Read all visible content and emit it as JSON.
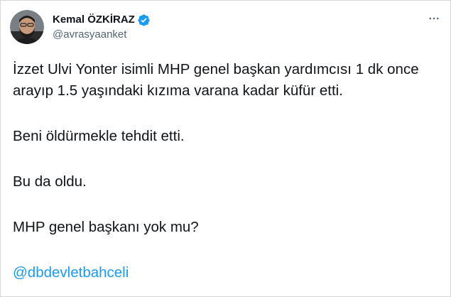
{
  "author": {
    "display_name": "Kemal ÖZKİRAZ",
    "handle": "@avrasyaanket",
    "verified": true,
    "avatar_icon": "profile-photo-man-beard"
  },
  "menu_icon": "more-horizontal-icon",
  "tweet": {
    "paragraphs": [
      "İzzet Ulvi Yonter isimli MHP genel başkan yardımcısı 1 dk once arayıp 1.5 yaşındaki kızıma varana kadar küfür etti.",
      "Beni öldürmekle tehdit etti.",
      "Bu da oldu.",
      "MHP genel başkanı yok mu?"
    ],
    "mention": "@dbdevletbahceli"
  },
  "colors": {
    "link": "#1d9bf0",
    "verified_badge": "#1d9bf0",
    "secondary_text": "#536471",
    "primary_text": "#0f1419",
    "border": "#d6d6d6"
  }
}
